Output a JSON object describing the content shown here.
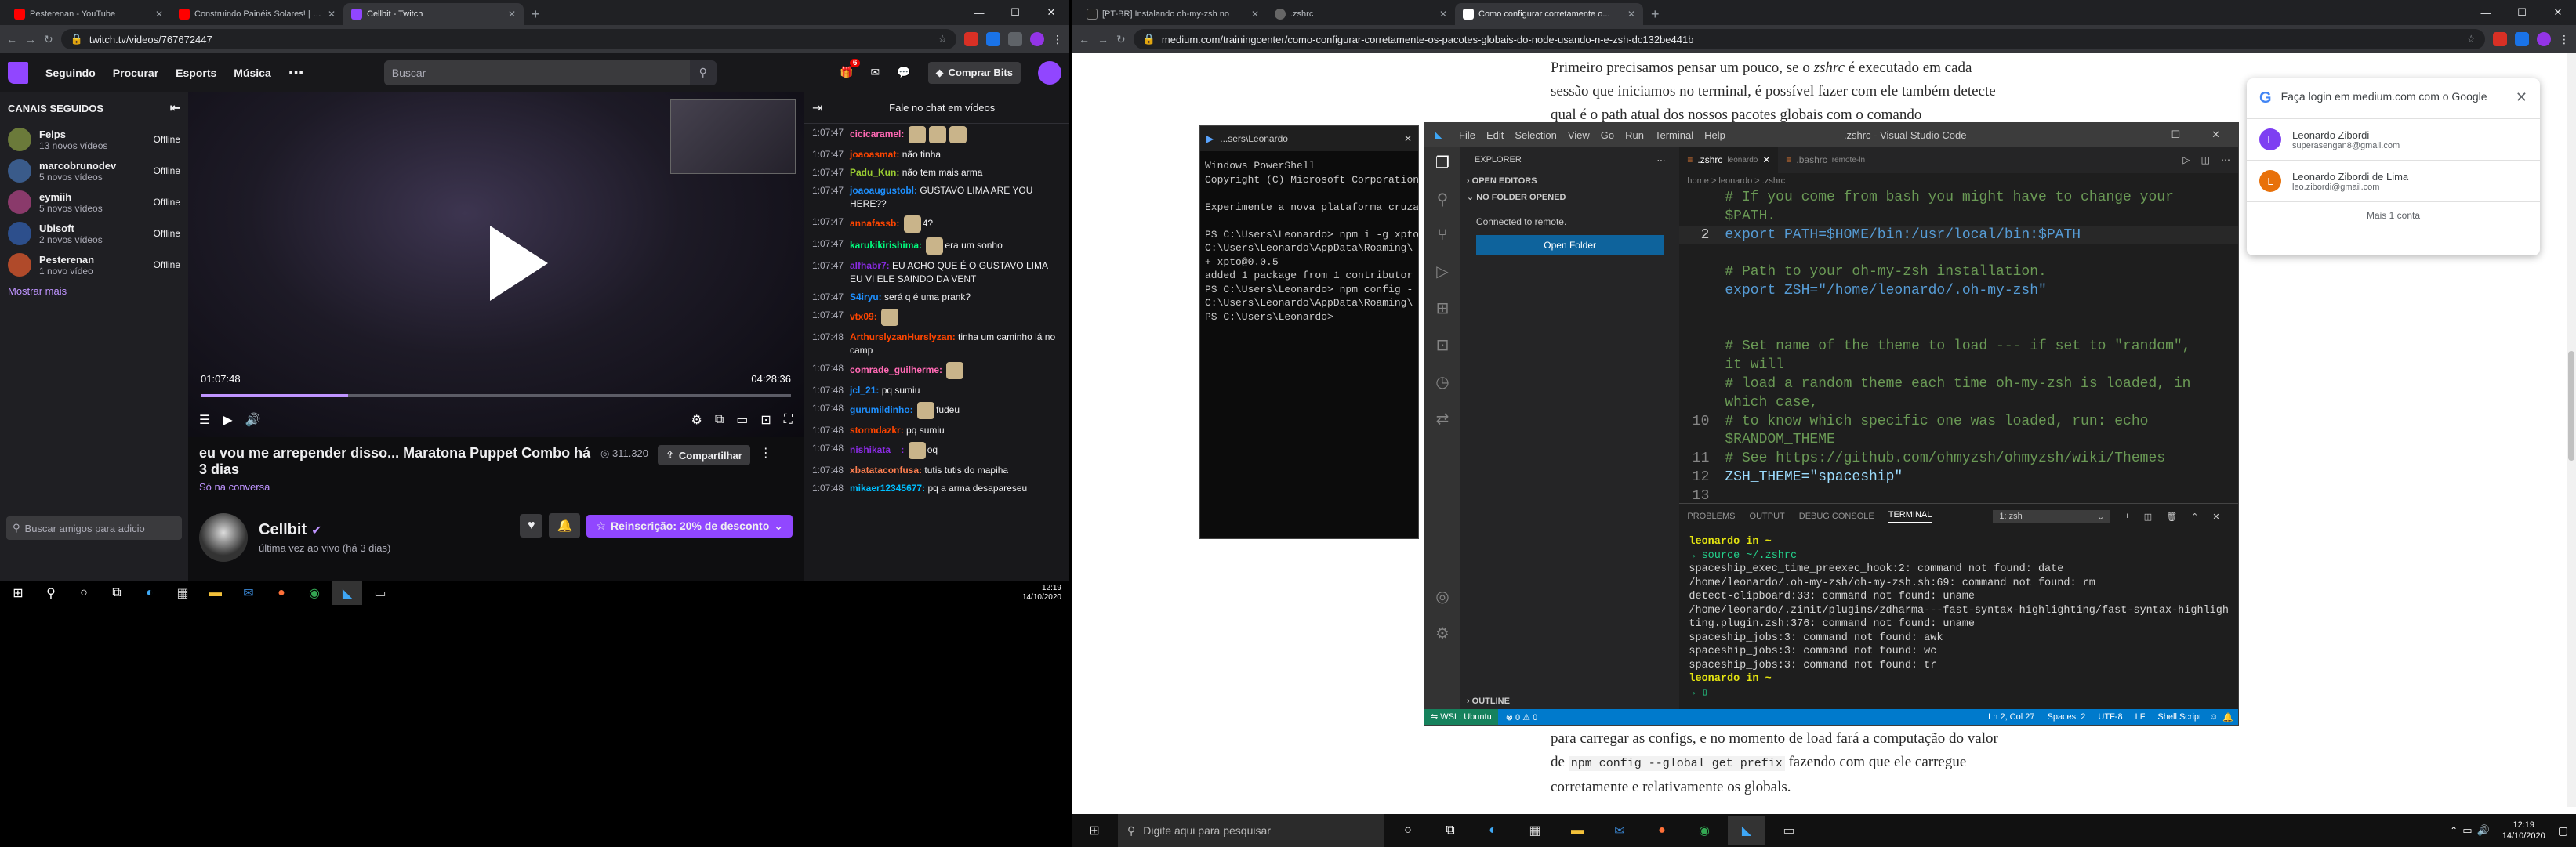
{
  "left_browser": {
    "tabs": [
      {
        "title": "Pesterenan - YouTube",
        "color": "#ff0000"
      },
      {
        "title": "Construindo Painéis Solares! | Pa",
        "color": "#ff0000"
      },
      {
        "title": "Cellbit - Twitch",
        "color": "#9146ff"
      }
    ],
    "url": "twitch.tv/videos/767672447"
  },
  "twitch": {
    "nav": [
      "Seguindo",
      "Procurar",
      "Esports",
      "Música"
    ],
    "search_placeholder": "Buscar",
    "notif_count": "6",
    "bits_button": "Comprar Bits",
    "sidebar_title": "CANAIS SEGUIDOS",
    "channels": [
      {
        "name": "Felps",
        "sub": "13 novos vídeos",
        "status": "Offline",
        "color": "#6b7a3a"
      },
      {
        "name": "marcobrunodev",
        "sub": "5 novos vídeos",
        "status": "Offline",
        "color": "#3a5b8a"
      },
      {
        "name": "eymiih",
        "sub": "5 novos vídeos",
        "status": "Offline",
        "color": "#8a3a6b"
      },
      {
        "name": "Ubisoft",
        "sub": "2 novos vídeos",
        "status": "Offline",
        "color": "#2d4f8c"
      },
      {
        "name": "Pesterenan",
        "sub": "1 novo vídeo",
        "status": "Offline",
        "color": "#b04a2a"
      }
    ],
    "show_more": "Mostrar mais",
    "friends_search": "Buscar amigos para adicio",
    "video": {
      "time_current": "01:07:48",
      "time_total": "04:28:36",
      "progress": 0.25
    },
    "stream": {
      "title": "eu vou me arrepender disso... Maratona Puppet Combo há 3 dias",
      "viewers": "311.320",
      "share": "Compartilhar",
      "game": "Só na conversa",
      "channel": "Cellbit",
      "live_info": "última vez ao vivo (há 3 dias)",
      "subscribe": "Reinscrição: 20% de desconto"
    },
    "chat_header": "Fale no chat em vídeos",
    "chat": [
      {
        "time": "1:07:47",
        "user": "cicicaramel:",
        "color": "#ff69b4",
        "text": "",
        "emotes": 3
      },
      {
        "time": "1:07:47",
        "user": "joaoasmat:",
        "color": "#ff4500",
        "text": "não tinha",
        "emotes": 0
      },
      {
        "time": "1:07:47",
        "user": "Padu_Kun:",
        "color": "#9acd32",
        "text": "não tem mais arma",
        "emotes": 0
      },
      {
        "time": "1:07:47",
        "user": "joaoaugustobl:",
        "color": "#1e90ff",
        "text": "GUSTAVO LIMA ARE YOU HERE??",
        "emotes": 0
      },
      {
        "time": "1:07:47",
        "user": "annafassb:",
        "color": "#ff4500",
        "text": "4?",
        "emotes": 1
      },
      {
        "time": "1:07:47",
        "user": "karukikirishima:",
        "color": "#00ff7f",
        "text": "era um sonho",
        "emotes": 1
      },
      {
        "time": "1:07:47",
        "user": "alfhabr7:",
        "color": "#8a2be2",
        "text": "EU ACHO QUE É O GUSTAVO LIMA EU VI ELE SAINDO DA VENT",
        "emotes": 0
      },
      {
        "time": "1:07:47",
        "user": "S4iryu:",
        "color": "#1e90ff",
        "text": "será q é uma prank?",
        "emotes": 0
      },
      {
        "time": "1:07:47",
        "user": "vtx09:",
        "color": "#ff4500",
        "text": "",
        "emotes": 1
      },
      {
        "time": "1:07:48",
        "user": "ArthurslyzanHurslyzan:",
        "color": "#ff4500",
        "text": "tinha um caminho lá no camp",
        "emotes": 0
      },
      {
        "time": "1:07:48",
        "user": "comrade_guilherme:",
        "color": "#ff69b4",
        "text": "",
        "emotes": 1
      },
      {
        "time": "1:07:48",
        "user": "jcl_21:",
        "color": "#1e90ff",
        "text": "pq sumiu",
        "emotes": 0
      },
      {
        "time": "1:07:48",
        "user": "gurumildinho:",
        "color": "#1e90ff",
        "text": "fudeu",
        "emotes": 1
      },
      {
        "time": "1:07:48",
        "user": "stormdazkr:",
        "color": "#ff4500",
        "text": "pq sumiu",
        "emotes": 0
      },
      {
        "time": "1:07:48",
        "user": "nishikata__:",
        "color": "#8a2be2",
        "text": "oq",
        "emotes": 1
      },
      {
        "time": "1:07:48",
        "user": "xbatataconfusa:",
        "color": "#ff7f50",
        "text": "tutis tutis do mapiha",
        "emotes": 0
      },
      {
        "time": "1:07:48",
        "user": "mikaer12345677:",
        "color": "#00bfff",
        "text": "pq a arma desapareseu",
        "emotes": 0
      }
    ]
  },
  "left_taskbar": {
    "time": "12:19",
    "date": "14/10/2020"
  },
  "right_browser": {
    "tabs": [
      {
        "title": "[PT-BR] Instalando oh-my-zsh no",
        "color": "#222"
      },
      {
        "title": ".zshrc",
        "color": "#666"
      },
      {
        "title": "Como configurar corretamente o...",
        "color": "#000"
      }
    ],
    "url": "medium.com/trainingcenter/como-configurar-corretamente-os-pacotes-globais-do-node-usando-n-e-zsh-dc132be441b"
  },
  "medium": {
    "top_line1": "Primeiro precisamos pensar um pouco, se o",
    "top_em": "zshrc",
    "top_line1b": "é executado em cada",
    "top_line2": "sessão que iniciamos no terminal, é possível fazer com ele também detecte",
    "top_line3": "qual é o path atual dos nossos pacotes globais com o comando",
    "bottom_line1": "para carregar as configs, e no momento de load fará a computação do valor",
    "bottom_pre": "de",
    "bottom_code": "npm config --global get prefix",
    "bottom_post": "fazendo com que ele carregue",
    "bottom_line3": "corretamente e relativamente os globals."
  },
  "google_login": {
    "title": "Faça login em medium.com com o Google",
    "accounts": [
      {
        "name": "Leonardo Zibordi",
        "email": "superasengan8@gmail.com",
        "color": "#7e3ff2",
        "initial": "L"
      },
      {
        "name": "Leonardo Zibordi de Lima",
        "email": "leo.zibordi@gmail.com",
        "color": "#e8710a",
        "initial": "L"
      }
    ],
    "more": "Mais 1 conta"
  },
  "powershell": {
    "tab": "...sers\\Leonardo",
    "lines": [
      "Windows PowerShell",
      "Copyright (C) Microsoft Corporation",
      "",
      "Experimente a nova plataforma cruza",
      "",
      "PS C:\\Users\\Leonardo> npm i -g xpto",
      "C:\\Users\\Leonardo\\AppData\\Roaming\\",
      "+ xpto@0.0.5",
      "added 1 package from 1 contributor",
      "PS C:\\Users\\Leonardo> npm config -",
      "C:\\Users\\Leonardo\\AppData\\Roaming\\",
      "PS C:\\Users\\Leonardo>"
    ]
  },
  "vscode": {
    "menu": [
      "File",
      "Edit",
      "Selection",
      "View",
      "Go",
      "Run",
      "Terminal",
      "Help"
    ],
    "title": ".zshrc - Visual Studio Code",
    "explorer": "EXPLORER",
    "open_editors": "OPEN EDITORS",
    "no_folder": "NO FOLDER OPENED",
    "connected": "Connected to remote.",
    "open_folder": "Open Folder",
    "outline": "OUTLINE",
    "tabs": [
      {
        "name": ".zshrc",
        "hint": "leonardo"
      },
      {
        "name": ".bashrc",
        "hint": "remote-ln"
      }
    ],
    "breadcrumb": "home > leonardo > .zshrc",
    "code": [
      {
        "n": "",
        "text": "# If you come from bash you might have to change your",
        "kind": "comment"
      },
      {
        "n": "",
        "text": "$PATH.",
        "kind": "comment"
      },
      {
        "n": "2",
        "text": "export PATH=$HOME/bin:/usr/local/bin:$PATH",
        "kind": "export"
      },
      {
        "n": "",
        "text": "",
        "kind": "plain"
      },
      {
        "n": "",
        "text": "# Path to your oh-my-zsh installation.",
        "kind": "comment"
      },
      {
        "n": "",
        "text": "export ZSH=\"/home/leonardo/.oh-my-zsh\"",
        "kind": "export"
      },
      {
        "n": "",
        "text": "",
        "kind": "plain"
      },
      {
        "n": "",
        "text": "",
        "kind": "plain"
      },
      {
        "n": "",
        "text": "# Set name of the theme to load --- if set to \"random\",",
        "kind": "comment"
      },
      {
        "n": "",
        "text": "it will",
        "kind": "comment"
      },
      {
        "n": "",
        "text": "# load a random theme each time oh-my-zsh is loaded, in",
        "kind": "comment"
      },
      {
        "n": "",
        "text": "which case,",
        "kind": "comment"
      },
      {
        "n": "10",
        "text": "# to know which specific one was loaded, run: echo",
        "kind": "comment"
      },
      {
        "n": "",
        "text": "$RANDOM_THEME",
        "kind": "comment"
      },
      {
        "n": "11",
        "text": "# See https://github.com/ohmyzsh/ohmyzsh/wiki/Themes",
        "kind": "comment"
      },
      {
        "n": "12",
        "text": "ZSH_THEME=\"spaceship\"",
        "kind": "assign"
      },
      {
        "n": "13",
        "text": "",
        "kind": "plain"
      }
    ],
    "panel_tabs": [
      "PROBLEMS",
      "OUTPUT",
      "DEBUG CONSOLE",
      "TERMINAL"
    ],
    "terminal_select": "1: zsh",
    "terminal": [
      {
        "text": "leonardo in ~",
        "kind": "prompt"
      },
      {
        "text": "→ source ~/.zshrc",
        "kind": "cmd"
      },
      {
        "text": "spaceship_exec_time_preexec_hook:2: command not found: date",
        "kind": "out"
      },
      {
        "text": "/home/leonardo/.oh-my-zsh/oh-my-zsh.sh:69: command not found: rm",
        "kind": "out"
      },
      {
        "text": "detect-clipboard:33: command not found: uname",
        "kind": "out"
      },
      {
        "text": "/home/leonardo/.zinit/plugins/zdharma---fast-syntax-highlighting/fast-syntax-highligh",
        "kind": "out"
      },
      {
        "text": "ting.plugin.zsh:376: command not found: uname",
        "kind": "out"
      },
      {
        "text": "spaceship_jobs:3: command not found: awk",
        "kind": "out"
      },
      {
        "text": "spaceship_jobs:3: command not found: wc",
        "kind": "out"
      },
      {
        "text": "spaceship_jobs:3: command not found: tr",
        "kind": "out"
      },
      {
        "text": "leonardo in ~",
        "kind": "prompt"
      },
      {
        "text": "→ ▯",
        "kind": "cmd"
      }
    ],
    "status_remote": "WSL: Ubuntu",
    "status_problems": "⊗ 0 ⚠ 0",
    "status_right": [
      "Ln 2, Col 27",
      "Spaces: 2",
      "UTF-8",
      "LF",
      "Shell Script"
    ]
  },
  "right_taskbar": {
    "search": "Digite aqui para pesquisar",
    "time": "12:19",
    "date": "14/10/2020"
  }
}
